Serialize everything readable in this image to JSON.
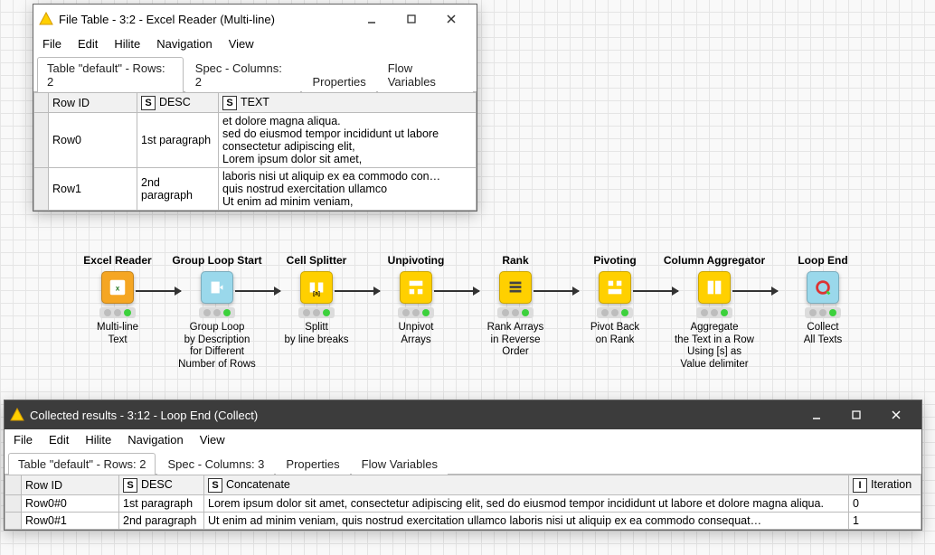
{
  "top_window": {
    "title": "File Table - 3:2 - Excel Reader (Multi-line)",
    "menu": [
      "File",
      "Edit",
      "Hilite",
      "Navigation",
      "View"
    ],
    "tabs": [
      "Table \"default\" - Rows: 2",
      "Spec - Columns: 2",
      "Properties",
      "Flow Variables"
    ],
    "active_tab": 0,
    "columns": [
      {
        "name": "Row ID",
        "type": ""
      },
      {
        "name": "DESC",
        "type": "S"
      },
      {
        "name": "TEXT",
        "type": "S"
      }
    ],
    "rows": [
      {
        "id": "Row0",
        "desc": "1st paragraph",
        "text": "et dolore magna aliqua.\nsed do eiusmod tempor incididunt ut labore\nconsectetur adipiscing elit,\nLorem ipsum dolor sit amet,"
      },
      {
        "id": "Row1",
        "desc": "2nd paragraph",
        "text": "laboris nisi ut aliquip ex ea commodo con…\nquis nostrud exercitation ullamco\nUt enim ad minim veniam,"
      }
    ]
  },
  "bottom_window": {
    "title": "Collected results - 3:12 - Loop End (Collect)",
    "menu": [
      "File",
      "Edit",
      "Hilite",
      "Navigation",
      "View"
    ],
    "tabs": [
      "Table \"default\" - Rows: 2",
      "Spec - Columns: 3",
      "Properties",
      "Flow Variables"
    ],
    "active_tab": 0,
    "columns": [
      {
        "name": "Row ID",
        "type": ""
      },
      {
        "name": "DESC",
        "type": "S"
      },
      {
        "name": "Concatenate",
        "type": "S"
      },
      {
        "name": "Iteration",
        "type": "I"
      }
    ],
    "rows": [
      {
        "id": "Row0#0",
        "desc": "1st paragraph",
        "concat": "Lorem ipsum dolor sit amet, consectetur adipiscing elit, sed do eiusmod tempor incididunt ut labore et dolore magna aliqua.",
        "iter": "0"
      },
      {
        "id": "Row0#1",
        "desc": "2nd paragraph",
        "concat": "Ut enim ad minim veniam, quis nostrud exercitation ullamco laboris nisi ut aliquip ex ea commodo consequat…",
        "iter": "1"
      }
    ]
  },
  "workflow": {
    "nodes": [
      {
        "title": "Excel Reader",
        "caption": "Multi-line\nText",
        "color": "#f5a623",
        "icon": "xls"
      },
      {
        "title": "Group Loop Start",
        "caption": "Group Loop\nby Description\nfor Different\nNumber of Rows",
        "color": "#9ad8eb",
        "icon": "loop-open"
      },
      {
        "title": "Cell Splitter",
        "caption": "Splitt\nby line breaks",
        "color": "#ffd000",
        "icon": "split"
      },
      {
        "title": "Unpivoting",
        "caption": "Unpivot\nArrays",
        "color": "#ffd000",
        "icon": "unpivot"
      },
      {
        "title": "Rank",
        "caption": "Rank Arrays\nin Reverse\nOrder",
        "color": "#ffd000",
        "icon": "rank"
      },
      {
        "title": "Pivoting",
        "caption": "Pivot Back\non Rank",
        "color": "#ffd000",
        "icon": "pivot"
      },
      {
        "title": "Column Aggregator",
        "caption": "Aggregate\nthe Text in a Row\nUsing [s] as\nValue delimiter",
        "color": "#ffd000",
        "icon": "agg"
      },
      {
        "title": "Loop End",
        "caption": "Collect\nAll Texts",
        "color": "#9ad8eb",
        "icon": "loop-close"
      }
    ]
  }
}
